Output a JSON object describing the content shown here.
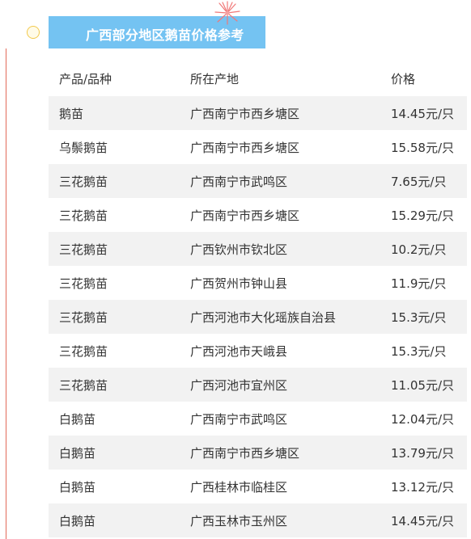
{
  "title": "广西部分地区鹅苗价格参考",
  "headers": {
    "product": "产品/品种",
    "location": "所在产地",
    "price": "价格"
  },
  "rows": [
    {
      "product": "鹅苗",
      "location": "广西南宁市西乡塘区",
      "price": "14.45元/只"
    },
    {
      "product": "乌鬃鹅苗",
      "location": "广西南宁市西乡塘区",
      "price": "15.58元/只"
    },
    {
      "product": "三花鹅苗",
      "location": "广西南宁市武鸣区",
      "price": "7.65元/只"
    },
    {
      "product": "三花鹅苗",
      "location": "广西南宁市西乡塘区",
      "price": "15.29元/只"
    },
    {
      "product": "三花鹅苗",
      "location": "广西钦州市钦北区",
      "price": "10.2元/只"
    },
    {
      "product": "三花鹅苗",
      "location": "广西贺州市钟山县",
      "price": "11.9元/只"
    },
    {
      "product": "三花鹅苗",
      "location": "广西河池市大化瑶族自治县",
      "price": "15.3元/只"
    },
    {
      "product": "三花鹅苗",
      "location": "广西河池市天峨县",
      "price": "15.3元/只"
    },
    {
      "product": "三花鹅苗",
      "location": "广西河池市宜州区",
      "price": "11.05元/只"
    },
    {
      "product": "白鹅苗",
      "location": "广西南宁市武鸣区",
      "price": "12.04元/只"
    },
    {
      "product": "白鹅苗",
      "location": "广西南宁市西乡塘区",
      "price": "13.79元/只"
    },
    {
      "product": "白鹅苗",
      "location": "广西桂林市临桂区",
      "price": "13.12元/只"
    },
    {
      "product": "白鹅苗",
      "location": "广西玉林市玉州区",
      "price": "14.45元/只"
    }
  ],
  "colors": {
    "title_bg": "#74c3f2",
    "row_shade": "#f2f2f2",
    "accent_line": "#e36b5a",
    "circle": "#f2c94c"
  }
}
